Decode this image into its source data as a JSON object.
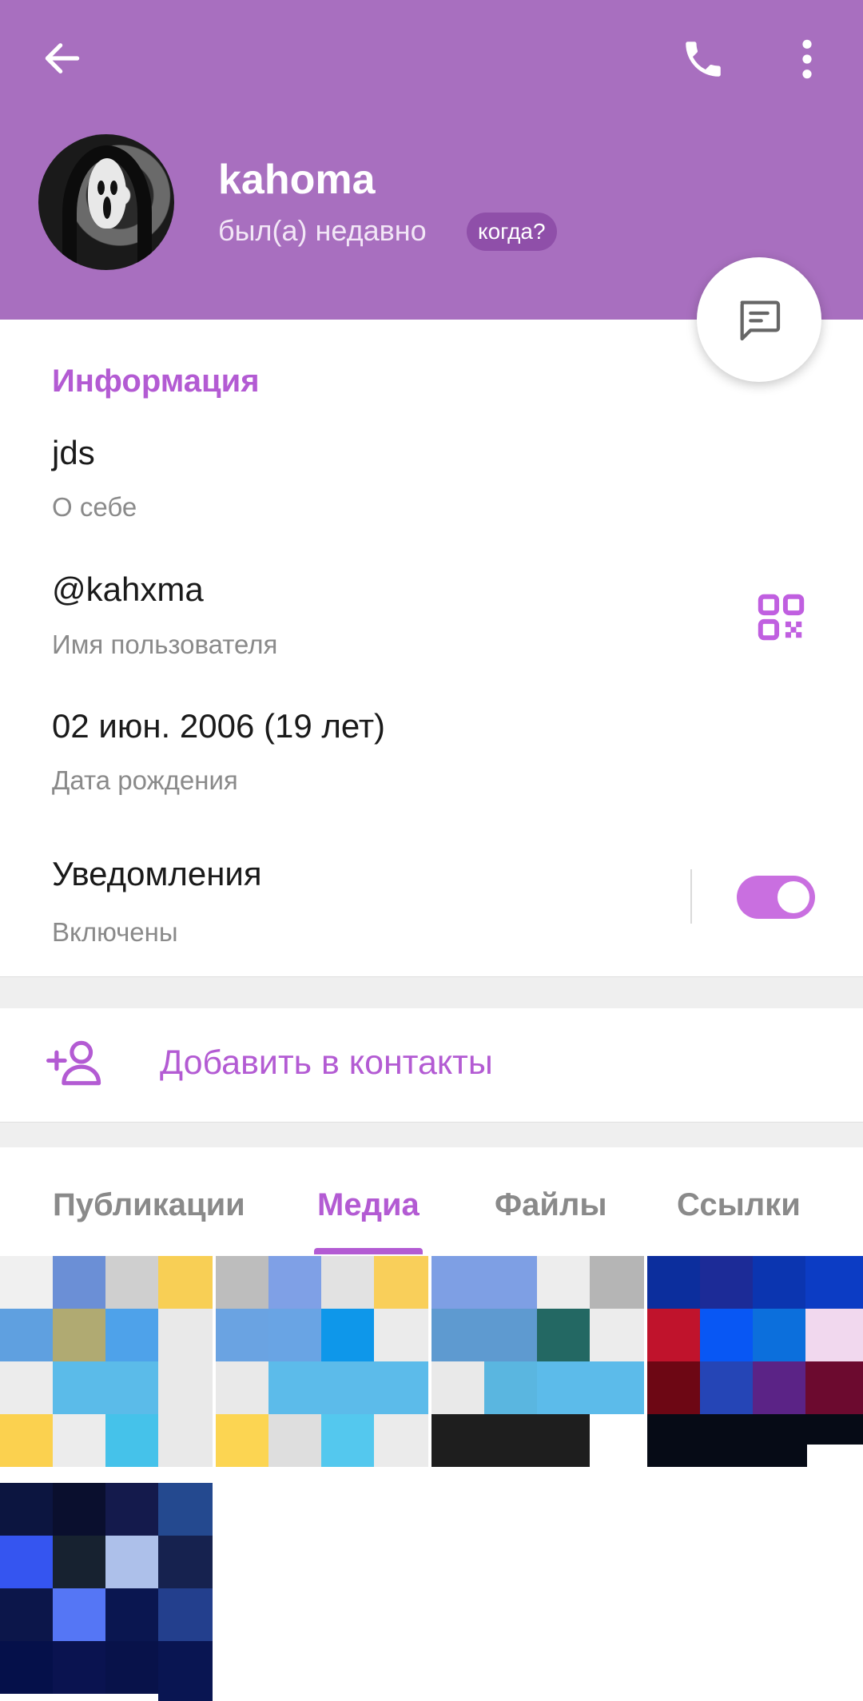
{
  "header": {
    "name": "kahoma",
    "status": "был(а) недавно",
    "when_badge": "когда?"
  },
  "info": {
    "section_title": "Информация",
    "bio_value": "jds",
    "bio_label": "О себе",
    "username_value": "@kahxma",
    "username_label": "Имя пользователя",
    "birthday_value": "02 июн. 2006 (19 лет)",
    "birthday_label": "Дата рождения",
    "notifications_value": "Уведомления",
    "notifications_label": "Включены",
    "notifications_on": true
  },
  "actions": {
    "add_contact": "Добавить в контакты"
  },
  "tabs": [
    {
      "label": "Публикации",
      "active": false
    },
    {
      "label": "Медиа",
      "active": true
    },
    {
      "label": "Файлы",
      "active": false
    },
    {
      "label": "Ссылки",
      "active": false
    }
  ],
  "colors": {
    "header_bg": "#a86fbf",
    "accent": "#b35bd3",
    "toggle": "#c96fe0"
  },
  "icons": [
    "back-arrow-icon",
    "phone-icon",
    "more-vertical-icon",
    "message-icon",
    "qr-code-icon",
    "add-user-icon"
  ]
}
